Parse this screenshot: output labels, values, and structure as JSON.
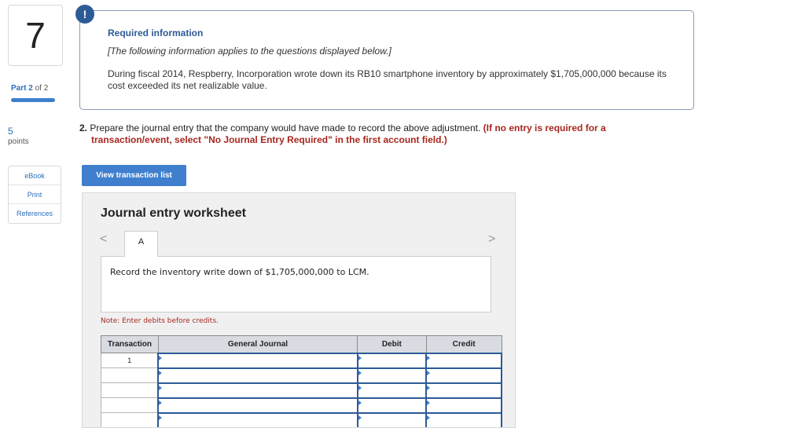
{
  "sidebar": {
    "question_number": "7",
    "part_label": "Part",
    "part_current": "2",
    "part_of": "of 2",
    "points_value": "5",
    "points_label": "points",
    "tools": [
      "eBook",
      "Print",
      "References"
    ]
  },
  "info": {
    "badge": "!",
    "title": "Required information",
    "note": "[The following information applies to the questions displayed below.]",
    "text": "During fiscal 2014, Respberry, Incorporation wrote down its RB10 smartphone inventory by approximately $1,705,000,000 because its cost exceeded its net realizable value."
  },
  "question": {
    "number": "2.",
    "text": "Prepare the journal entry that the company would have made to record the above adjustment.",
    "instruction": "(If no entry is required for a transaction/event, select \"No Journal Entry Required\" in the first account field.)"
  },
  "view_button_label": "View transaction list",
  "worksheet": {
    "title": "Journal entry worksheet",
    "nav_prev": "<",
    "nav_next": ">",
    "tab_label": "A",
    "description": "Record the inventory write down of $1,705,000,000 to LCM.",
    "note": "Note: Enter debits before credits.",
    "columns": [
      "Transaction",
      "General Journal",
      "Debit",
      "Credit"
    ],
    "rows": [
      {
        "transaction": "1"
      },
      {
        "transaction": ""
      },
      {
        "transaction": ""
      },
      {
        "transaction": ""
      },
      {
        "transaction": ""
      }
    ]
  },
  "colors": {
    "accent": "#3f7fce",
    "dark_blue": "#2d5b96",
    "instruction_red": "#a8271f"
  }
}
